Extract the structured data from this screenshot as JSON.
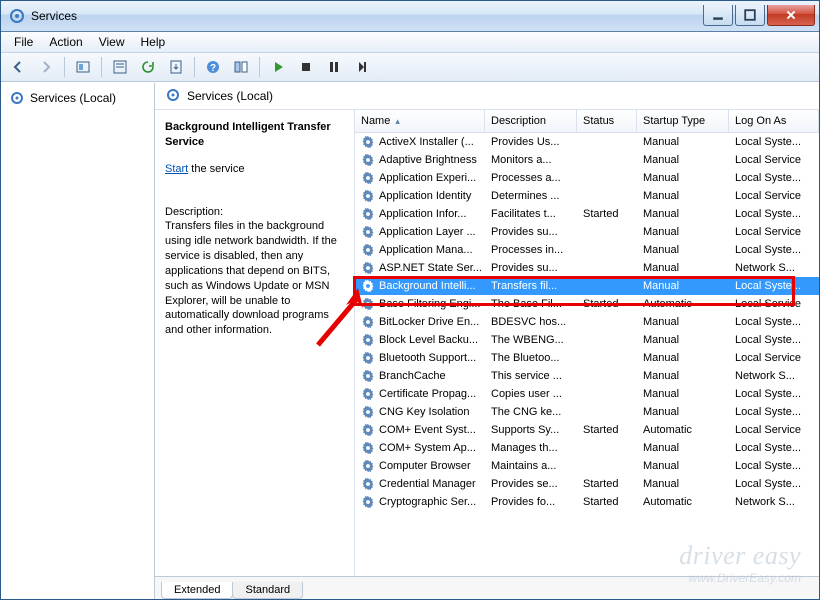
{
  "window": {
    "title": "Services"
  },
  "menubar": {
    "items": [
      "File",
      "Action",
      "View",
      "Help"
    ]
  },
  "toolbar_icons": [
    "back",
    "forward",
    "up-level",
    "show-hide",
    "refresh",
    "export",
    "help",
    "properties",
    "play",
    "stop",
    "pause",
    "restart"
  ],
  "nav": {
    "root": "Services (Local)"
  },
  "content": {
    "header": "Services (Local)",
    "selected_service": {
      "title": "Background Intelligent Transfer Service",
      "action_label": "Start",
      "action_suffix": " the service",
      "desc_heading": "Description:",
      "description": "Transfers files in the background using idle network bandwidth. If the service is disabled, then any applications that depend on BITS, such as Windows Update or MSN Explorer, will be unable to automatically download programs and other information."
    },
    "columns": [
      "Name",
      "Description",
      "Status",
      "Startup Type",
      "Log On As"
    ],
    "rows": [
      {
        "n": "ActiveX Installer (...",
        "d": "Provides Us...",
        "s": "",
        "t": "Manual",
        "l": "Local Syste..."
      },
      {
        "n": "Adaptive Brightness",
        "d": "Monitors a...",
        "s": "",
        "t": "Manual",
        "l": "Local Service"
      },
      {
        "n": "Application Experi...",
        "d": "Processes a...",
        "s": "",
        "t": "Manual",
        "l": "Local Syste..."
      },
      {
        "n": "Application Identity",
        "d": "Determines ...",
        "s": "",
        "t": "Manual",
        "l": "Local Service"
      },
      {
        "n": "Application Infor...",
        "d": "Facilitates t...",
        "s": "Started",
        "t": "Manual",
        "l": "Local Syste..."
      },
      {
        "n": "Application Layer ...",
        "d": "Provides su...",
        "s": "",
        "t": "Manual",
        "l": "Local Service"
      },
      {
        "n": "Application Mana...",
        "d": "Processes in...",
        "s": "",
        "t": "Manual",
        "l": "Local Syste..."
      },
      {
        "n": "ASP.NET State Ser...",
        "d": "Provides su...",
        "s": "",
        "t": "Manual",
        "l": "Network S..."
      },
      {
        "n": "Background Intelli...",
        "d": "Transfers fil...",
        "s": "",
        "t": "Manual",
        "l": "Local Syste...",
        "selected": true
      },
      {
        "n": "Base Filtering Engi...",
        "d": "The Base Fil...",
        "s": "Started",
        "t": "Automatic",
        "l": "Local Service"
      },
      {
        "n": "BitLocker Drive En...",
        "d": "BDESVC hos...",
        "s": "",
        "t": "Manual",
        "l": "Local Syste..."
      },
      {
        "n": "Block Level Backu...",
        "d": "The WBENG...",
        "s": "",
        "t": "Manual",
        "l": "Local Syste..."
      },
      {
        "n": "Bluetooth Support...",
        "d": "The Bluetoo...",
        "s": "",
        "t": "Manual",
        "l": "Local Service"
      },
      {
        "n": "BranchCache",
        "d": "This service ...",
        "s": "",
        "t": "Manual",
        "l": "Network S..."
      },
      {
        "n": "Certificate Propag...",
        "d": "Copies user ...",
        "s": "",
        "t": "Manual",
        "l": "Local Syste..."
      },
      {
        "n": "CNG Key Isolation",
        "d": "The CNG ke...",
        "s": "",
        "t": "Manual",
        "l": "Local Syste..."
      },
      {
        "n": "COM+ Event Syst...",
        "d": "Supports Sy...",
        "s": "Started",
        "t": "Automatic",
        "l": "Local Service"
      },
      {
        "n": "COM+ System Ap...",
        "d": "Manages th...",
        "s": "",
        "t": "Manual",
        "l": "Local Syste..."
      },
      {
        "n": "Computer Browser",
        "d": "Maintains a...",
        "s": "",
        "t": "Manual",
        "l": "Local Syste..."
      },
      {
        "n": "Credential Manager",
        "d": "Provides se...",
        "s": "Started",
        "t": "Manual",
        "l": "Local Syste..."
      },
      {
        "n": "Cryptographic Ser...",
        "d": "Provides fo...",
        "s": "Started",
        "t": "Automatic",
        "l": "Network S..."
      }
    ],
    "tabs": [
      "Extended",
      "Standard"
    ]
  },
  "watermark": {
    "line1": "driver easy",
    "line2": "www.DriverEasy.com"
  }
}
